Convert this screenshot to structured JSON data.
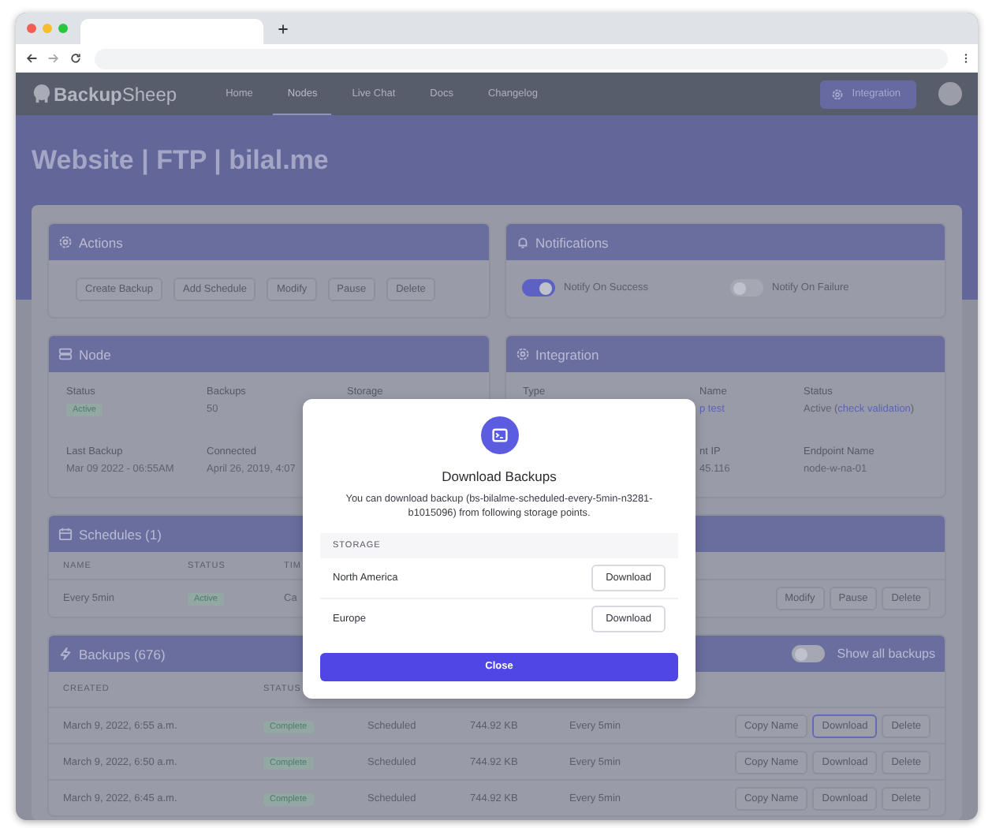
{
  "nav": {
    "logo": "**Backup**Sheep",
    "items": [
      {
        "label": "Home",
        "selected": false
      },
      {
        "label": "Nodes",
        "selected": true
      },
      {
        "label": "Live Chat",
        "selected": false
      },
      {
        "label": "Docs",
        "selected": false
      },
      {
        "label": "Changelog",
        "selected": false
      }
    ],
    "integration_button": "Integration"
  },
  "page_title": "Website | FTP | bilal.me",
  "actions": {
    "title": "Actions",
    "buttons": [
      "Create Backup",
      "Add Schedule",
      "Modify",
      "Pause",
      "Delete"
    ]
  },
  "notifications": {
    "title": "Notifications",
    "toggles": [
      {
        "label": "Notify On Success",
        "on": true
      },
      {
        "label": "Notify On Failure",
        "on": false
      }
    ]
  },
  "node": {
    "title": "Node",
    "columns": [
      {
        "cut_left": false,
        "fields": [
          {
            "label": "Status",
            "value": "Active",
            "kind": "badge"
          },
          {
            "label": "Last Backup",
            "value": "Mar 09 2022 - 06:55AM",
            "kind": "text"
          }
        ]
      },
      {
        "cut_left": false,
        "fields": [
          {
            "label": "Backups",
            "value": "50",
            "kind": "text"
          },
          {
            "label": "Connected",
            "value": "April 26, 2019, 4:07",
            "kind": "text"
          }
        ]
      },
      {
        "cut_left": false,
        "fields": [
          {
            "label": "Storage"
          }
        ]
      }
    ]
  },
  "integration": {
    "title": "Integration",
    "columns": [
      {
        "cut_left": false,
        "fields": [
          {
            "label": "Type"
          }
        ]
      },
      {
        "cut_left": true,
        "fields": [
          {
            "label": "Name",
            "value": "p test",
            "kind": "link"
          },
          {
            "label": "nt IP",
            "value": "45.116",
            "kind": "text"
          }
        ]
      },
      {
        "cut_left": false,
        "fields": [
          {
            "label": "Status",
            "value": "Active (",
            "link": "check validation",
            "value_end": ")",
            "kind": "text"
          },
          {
            "label": "Endpoint Name",
            "value": "node-w-na-01",
            "kind": "text"
          }
        ]
      }
    ]
  },
  "schedules": {
    "title": "Schedules (1)",
    "columns": [
      "NAME",
      "STATUS",
      "TIM"
    ],
    "rows": [
      {
        "name": "Every 5min",
        "status": "Active",
        "time": "Ca",
        "buttons": [
          "Modify",
          "Pause",
          "Delete"
        ]
      }
    ]
  },
  "backups": {
    "title": "Backups (676)",
    "toggle": {
      "label": "Show all backups",
      "on": false
    },
    "columns": [
      "CREATED",
      "STATUS"
    ],
    "rows": [
      {
        "created": "March 9, 2022, 6:55 a.m.",
        "status": "Complete",
        "type": "Scheduled",
        "size": "744.92 KB",
        "schedule": "Every 5min",
        "buttons": [
          {
            "label": "Copy Name",
            "focused": false
          },
          {
            "label": "Download",
            "focused": true
          },
          {
            "label": "Delete",
            "focused": false
          }
        ]
      },
      {
        "created": "March 9, 2022, 6:50 a.m.",
        "status": "Complete",
        "type": "Scheduled",
        "size": "744.92 KB",
        "schedule": "Every 5min",
        "buttons": [
          {
            "label": "Copy Name",
            "focused": false
          },
          {
            "label": "Download",
            "focused": false
          },
          {
            "label": "Delete",
            "focused": false
          }
        ]
      },
      {
        "created": "March 9, 2022, 6:45 a.m.",
        "status": "Complete",
        "type": "Scheduled",
        "size": "744.92 KB",
        "schedule": "Every 5min",
        "buttons": [
          {
            "label": "Copy Name",
            "focused": false
          },
          {
            "label": "Download",
            "focused": false
          },
          {
            "label": "Delete",
            "focused": false
          }
        ]
      }
    ]
  },
  "modal": {
    "title": "Download Backups",
    "description": "You can download backup (bs-bilalme-scheduled-every-5min-n3281-b1015096) from following storage points.",
    "storage_header": "STORAGE",
    "storages": [
      {
        "name": "North America",
        "button": "Download"
      },
      {
        "name": "Europe",
        "button": "Download"
      }
    ],
    "close_button": "Close"
  }
}
